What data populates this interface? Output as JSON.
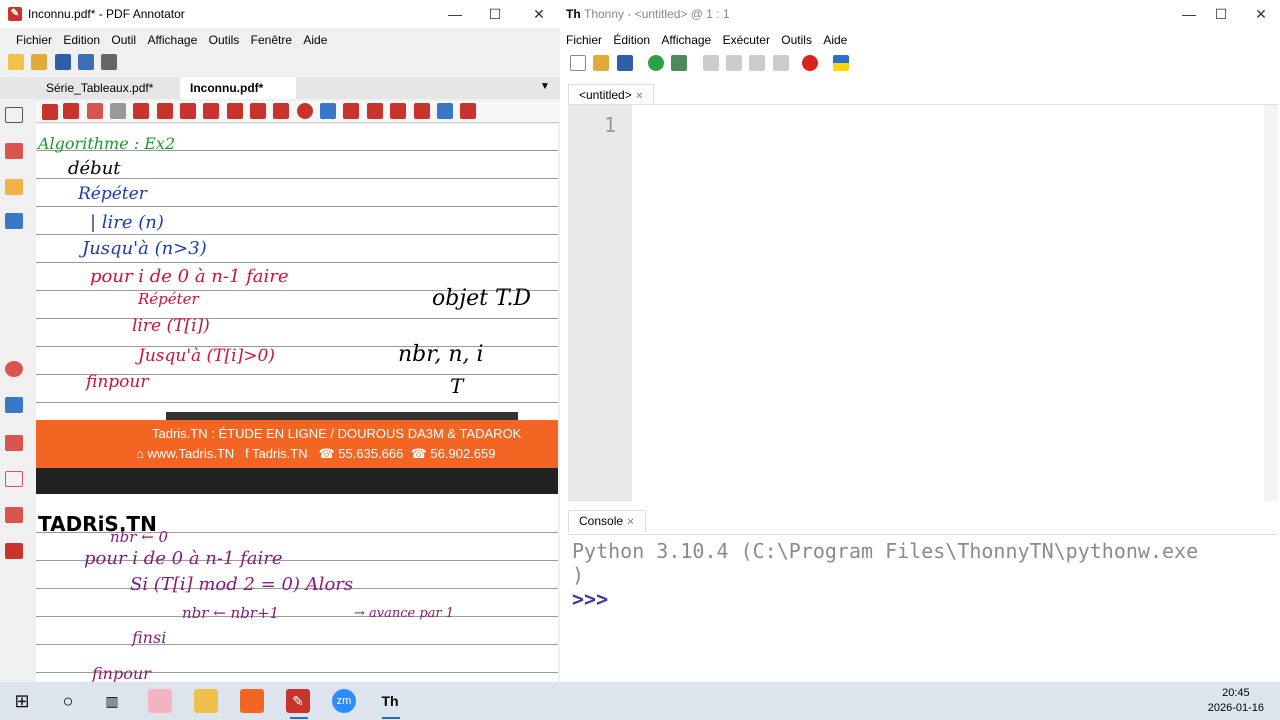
{
  "pdf_annotator": {
    "window_title": "Inconnu.pdf* - PDF Annotator",
    "menu": [
      "Fichier",
      "Edition",
      "Outil",
      "Affichage",
      "Outils",
      "Fenêtre",
      "Aide"
    ],
    "tabs": [
      "Série_Tableaux.pdf*",
      "Inconnu.pdf*"
    ],
    "page": {
      "handwriting_1": [
        "Algorithme : Ex2",
        "début",
        "Répéter",
        "| lire (n)",
        "Jusqu'à (n>3)",
        "pour i de 0 à n-1 faire",
        "Répéter",
        "lire (T[i])",
        "Jusqu'à (T[i]>0)",
        "finpour",
        "objet T.D",
        "nbr, n, i",
        "T"
      ],
      "banner_line1": "Tadris.TN : ÉTUDE EN LIGNE / DOUROUS DA3M & TADAROK",
      "banner_web": "www.Tadris.TN",
      "banner_fb": "Tadris.TN",
      "banner_phone1": "55.635.666",
      "banner_phone2": "56.902.659",
      "logo_text": "TADRiS.TN",
      "handwriting_2": [
        "nbr ← 0",
        "pour i de 0 à n-1 faire",
        "Si (T[i] mod 2 = 0) Alors",
        "nbr ← nbr+1",
        "→ avance par 1",
        "finsi",
        "finpour"
      ]
    },
    "colors": {
      "banner": "#f26522",
      "accent_red": "#c8342c"
    }
  },
  "thonny": {
    "window_title": "Thonny - <untitled> @ 1 : 1",
    "menu": [
      "Fichier",
      "Édition",
      "Affichage",
      "Exécuter",
      "Outils",
      "Aide"
    ],
    "editor_tab": "<untitled>",
    "line_number": "1",
    "shell_tab": "Console",
    "shell_line1": "Python 3.10.4 (C:\\Program Files\\ThonnyTN\\pythonw.exe",
    "shell_line2": ")",
    "shell_prompt": ">>>"
  },
  "taskbar": {
    "time": "20:45",
    "date": "2026-01-16"
  }
}
